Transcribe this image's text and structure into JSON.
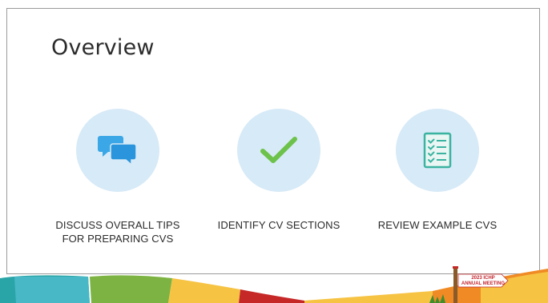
{
  "slide": {
    "title": "Overview"
  },
  "items": [
    {
      "label_line1": "DISCUSS OVERALL TIPS",
      "label_line2": "FOR PREPARING CVS",
      "icon": "chat-bubbles-icon"
    },
    {
      "label_line1": "IDENTIFY CV SECTIONS",
      "label_line2": "",
      "icon": "checkmark-icon"
    },
    {
      "label_line1": "REVIEW EXAMPLE CVS",
      "label_line2": "",
      "icon": "checklist-icon"
    }
  ],
  "badge": {
    "line1": "2023 ICHP",
    "line2": "ANNUAL MEETING"
  },
  "colors": {
    "circle": "#d7eaf7",
    "icon_blue": "#3ba7e6",
    "icon_green": "#6cc24a",
    "icon_teal": "#3bb3a1",
    "band_teal": "#2aa5a7",
    "band_green": "#7cb342",
    "band_yellow": "#f6c343",
    "band_orange": "#f08a24",
    "band_red": "#c62828"
  }
}
